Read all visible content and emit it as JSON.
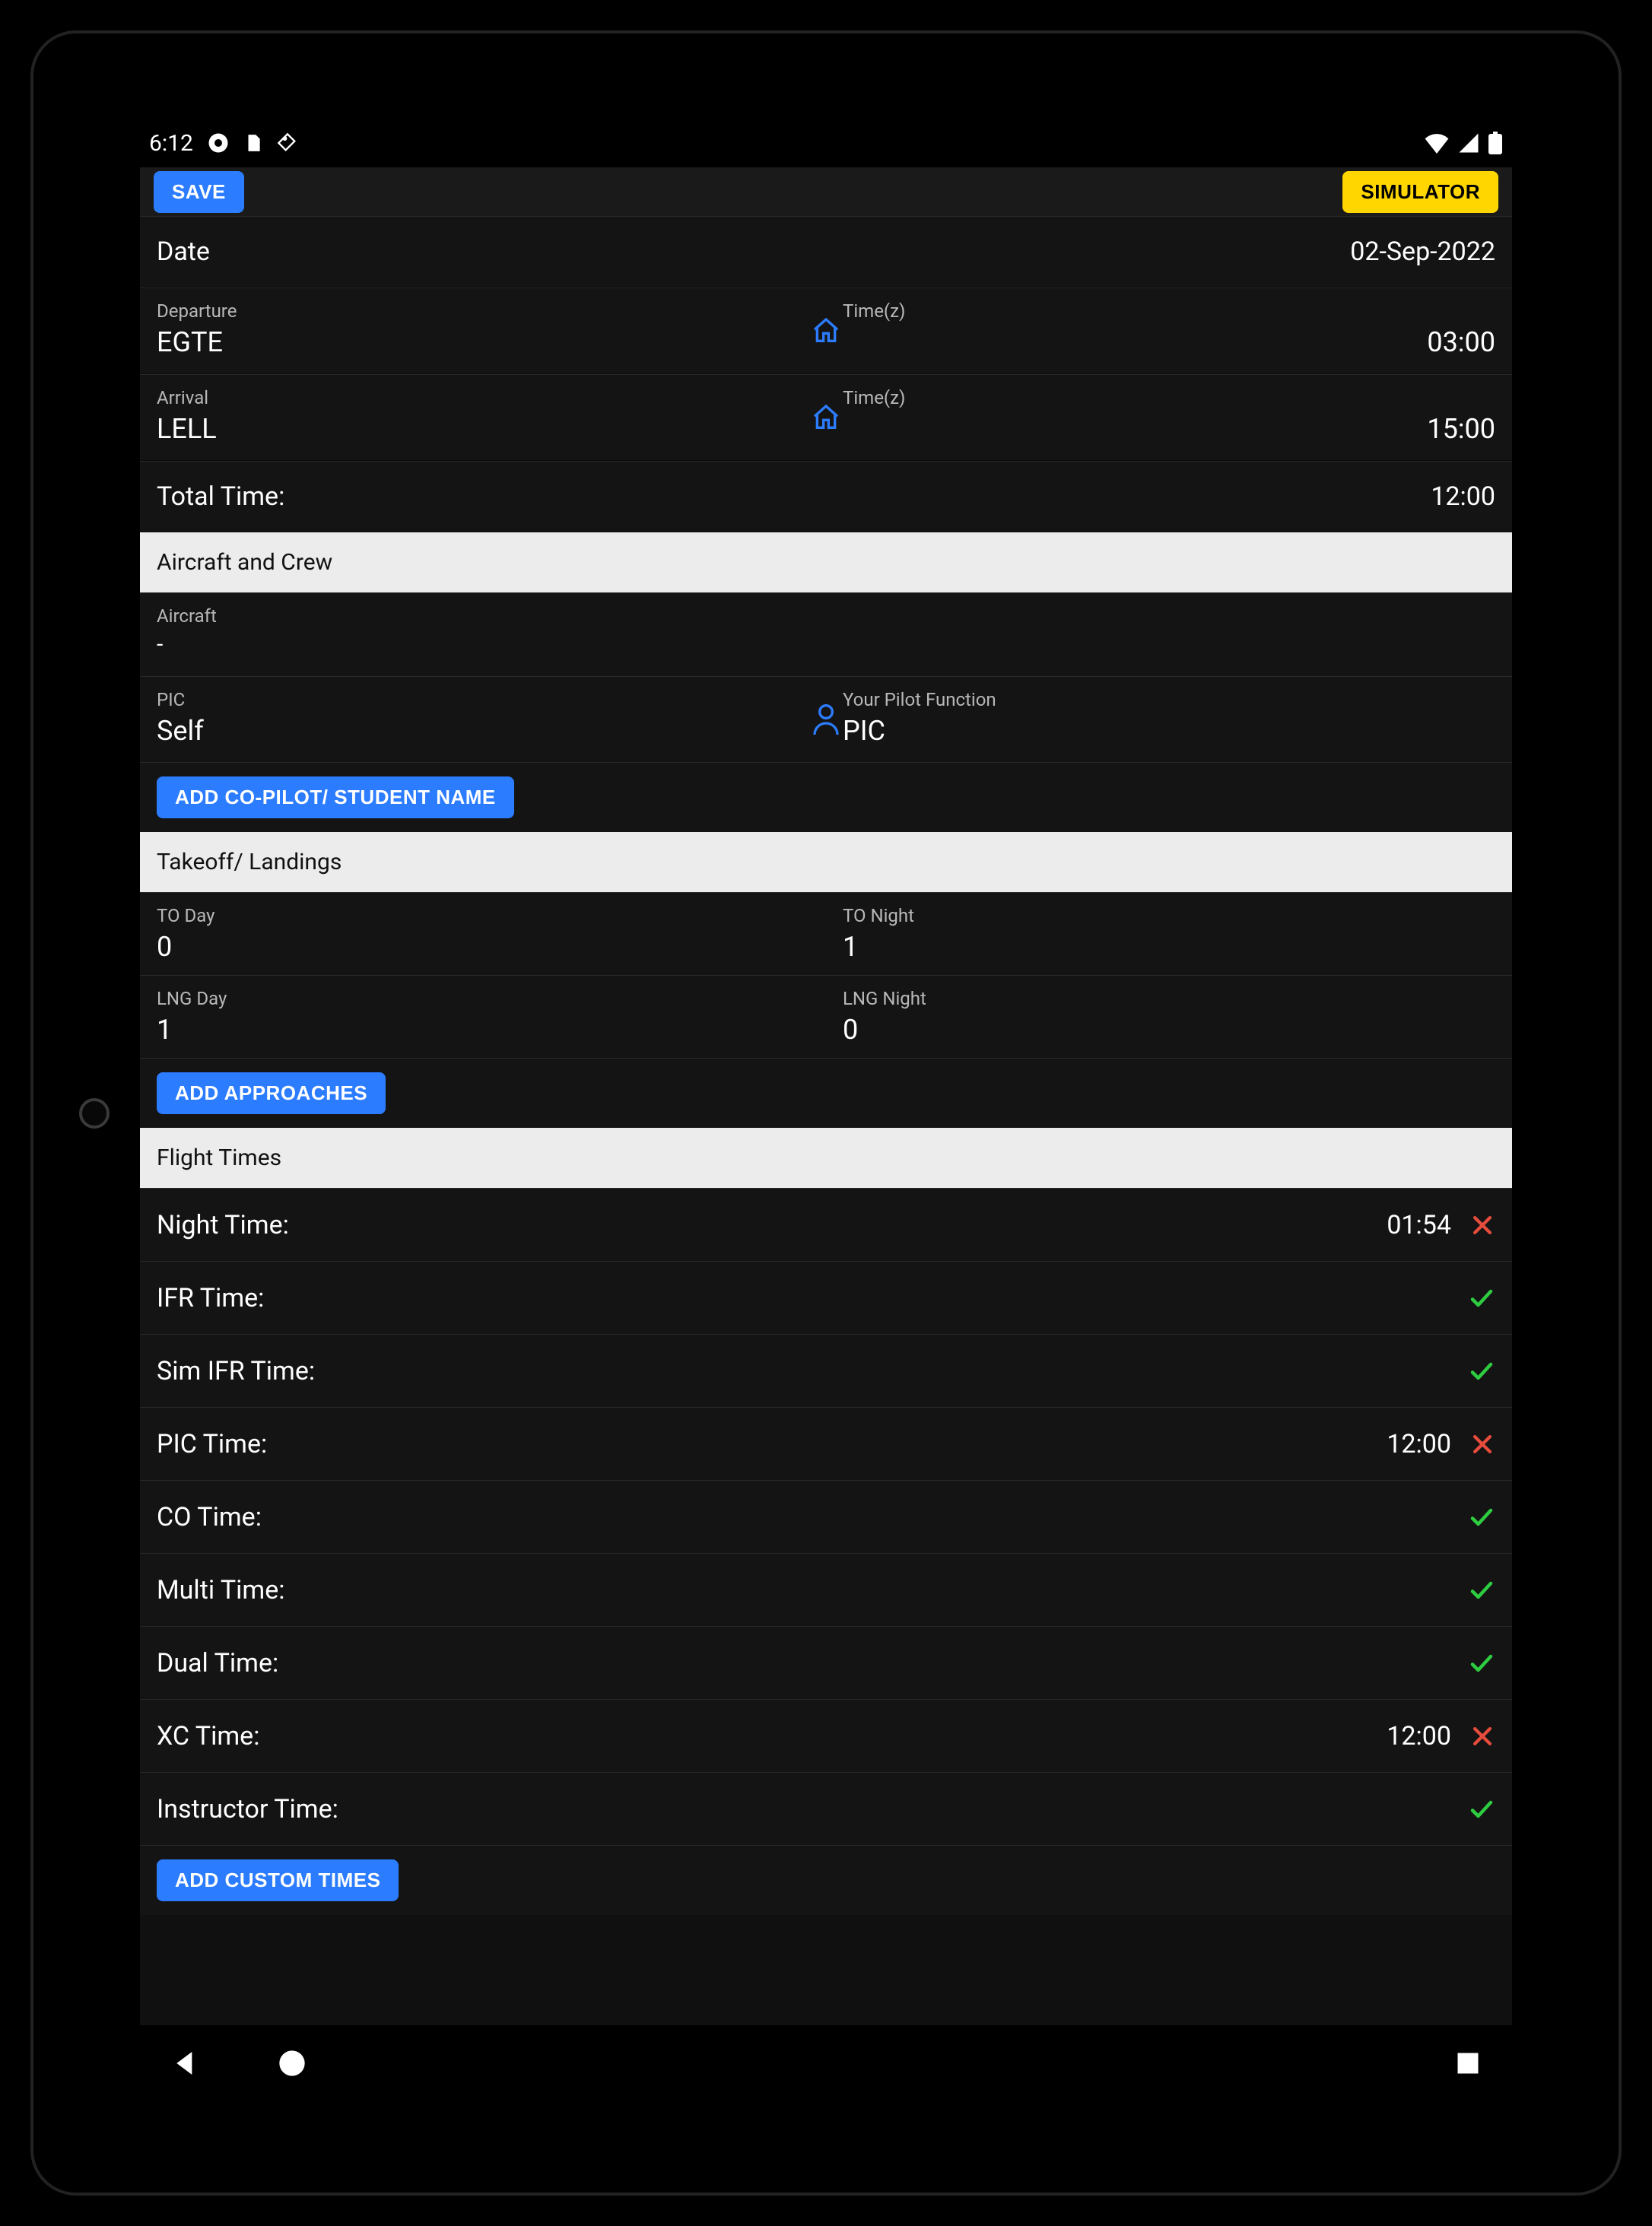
{
  "statusbar": {
    "time": "6:12"
  },
  "appbar": {
    "save": "SAVE",
    "simulator": "SIMULATOR"
  },
  "date": {
    "label": "Date",
    "value": "02-Sep-2022"
  },
  "departure": {
    "label": "Departure",
    "code": "EGTE",
    "time_label": "Time(z)",
    "time": "03:00"
  },
  "arrival": {
    "label": "Arrival",
    "code": "LELL",
    "time_label": "Time(z)",
    "time": "15:00"
  },
  "total_time": {
    "label": "Total Time:",
    "value": "12:00"
  },
  "sections": {
    "aircraft_crew": "Aircraft and Crew",
    "takeoff_landings": "Takeoff/ Landings",
    "flight_times": "Flight Times"
  },
  "aircraft": {
    "label": "Aircraft",
    "value": "-"
  },
  "pic": {
    "label": "PIC",
    "value": "Self",
    "function_label": "Your Pilot Function",
    "function_value": "PIC"
  },
  "buttons": {
    "add_copilot": "ADD CO-PILOT/ STUDENT NAME",
    "add_approaches": "ADD APPROACHES",
    "add_custom_times": "ADD CUSTOM TIMES"
  },
  "tolng": {
    "to_day_label": "TO Day",
    "to_day_value": "0",
    "to_night_label": "TO Night",
    "to_night_value": "1",
    "lng_day_label": "LNG Day",
    "lng_day_value": "1",
    "lng_night_label": "LNG Night",
    "lng_night_value": "0"
  },
  "flight_times": [
    {
      "label": "Night Time:",
      "value": "01:54",
      "status": "x"
    },
    {
      "label": "IFR Time:",
      "value": "",
      "status": "check"
    },
    {
      "label": "Sim IFR Time:",
      "value": "",
      "status": "check"
    },
    {
      "label": "PIC Time:",
      "value": "12:00",
      "status": "x"
    },
    {
      "label": "CO Time:",
      "value": "",
      "status": "check"
    },
    {
      "label": "Multi Time:",
      "value": "",
      "status": "check"
    },
    {
      "label": "Dual Time:",
      "value": "",
      "status": "check"
    },
    {
      "label": "XC Time:",
      "value": "12:00",
      "status": "x"
    },
    {
      "label": "Instructor Time:",
      "value": "",
      "status": "check"
    }
  ]
}
